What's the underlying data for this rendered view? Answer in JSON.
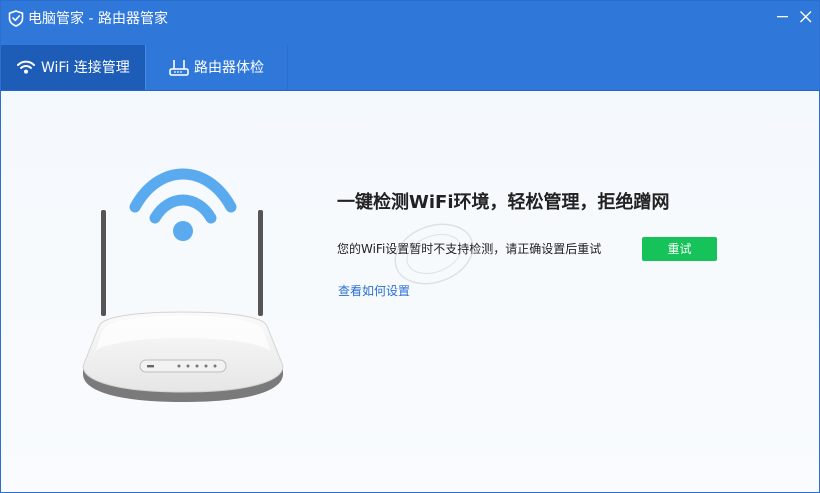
{
  "window": {
    "title": "电脑管家 - 路由器管家",
    "logo_icon": "shield-icon",
    "minimize_icon": "minimize-icon",
    "close_icon": "close-icon"
  },
  "tabs": [
    {
      "label": "WiFi 连接管理",
      "icon": "wifi-icon",
      "active": true
    },
    {
      "label": "路由器体检",
      "icon": "router-icon",
      "active": false
    }
  ],
  "content": {
    "headline": "一键检测WiFi环境，轻松管理，拒绝蹭网",
    "message": "您的WiFi设置暂时不支持检测，请正确设置后重试",
    "retry_label": "重试",
    "help_link": "查看如何设置"
  },
  "colors": {
    "titlebar": "#2f78d9",
    "active_tab": "#1d5db8",
    "retry_button": "#16c25a",
    "link": "#2a6fd1",
    "wifi_signal": "#5aaaf0"
  }
}
